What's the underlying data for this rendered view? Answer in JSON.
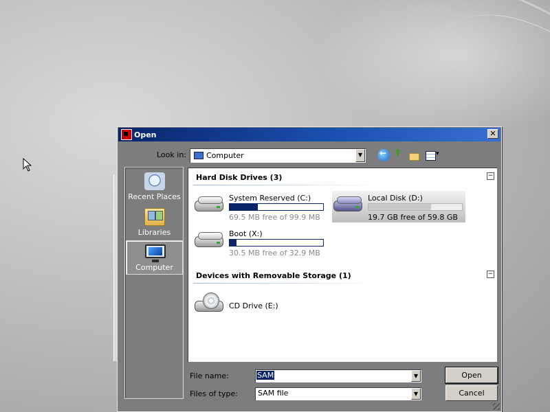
{
  "dialog": {
    "title": "Open",
    "close_glyph": "✕"
  },
  "look_in": {
    "label": "Look in:",
    "value": "Computer"
  },
  "places": [
    {
      "label": "Recent Places",
      "icon": "recent-places-icon"
    },
    {
      "label": "Libraries",
      "icon": "libraries-icon"
    },
    {
      "label": "Computer",
      "icon": "computer-icon",
      "selected": true
    }
  ],
  "groups": {
    "hard_disks": {
      "title": "Hard Disk Drives (3)",
      "collapse_glyph": "−",
      "drives": [
        {
          "name": "System Reserved (C:)",
          "free_text": "69.5 MB free of 99.9 MB",
          "used_fraction": 0.3
        },
        {
          "name": "Local Disk (D:)",
          "free_text": "19.7 GB free of 59.8 GB",
          "used_fraction": 0.67,
          "selected": true
        },
        {
          "name": "Boot (X:)",
          "free_text": "30.5 MB free of 32.9 MB",
          "used_fraction": 0.07
        }
      ]
    },
    "removable": {
      "title": "Devices with Removable Storage (1)",
      "collapse_glyph": "−",
      "devices": [
        {
          "name": "CD Drive (E:)"
        }
      ]
    }
  },
  "file_name": {
    "label": "File name:",
    "value": "SAM"
  },
  "file_type": {
    "label": "Files of type:",
    "value": "SAM file"
  },
  "buttons": {
    "open": "Open",
    "cancel": "Cancel"
  },
  "dropdown_glyph": "▼"
}
